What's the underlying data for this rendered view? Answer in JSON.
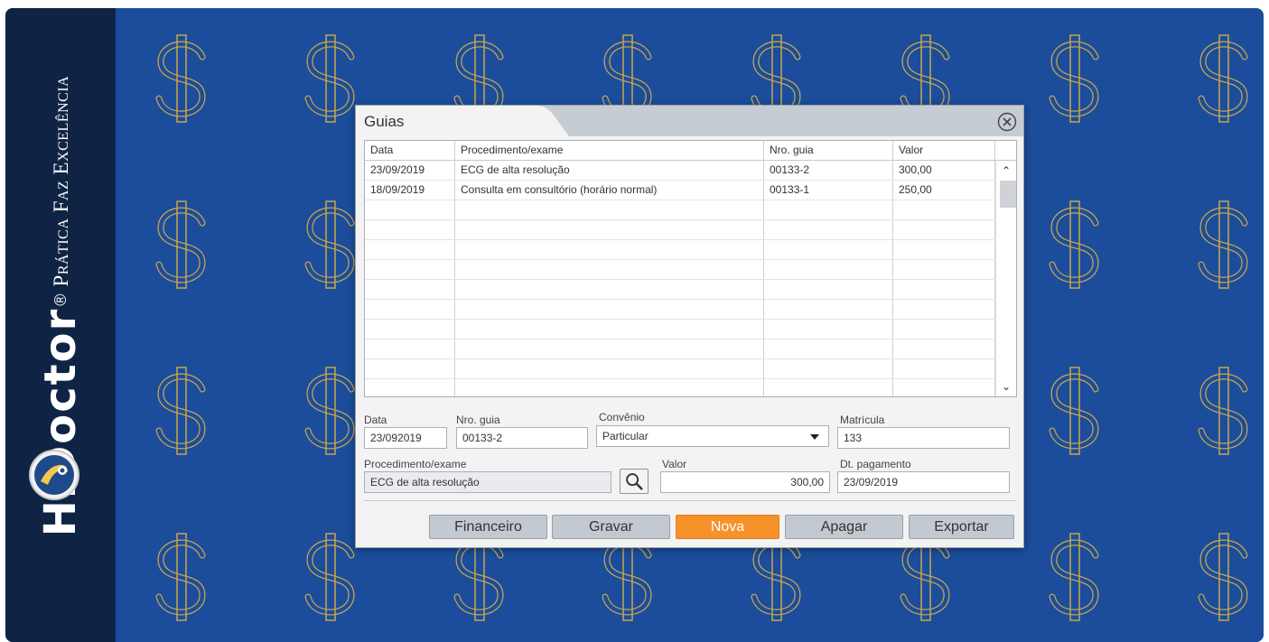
{
  "brand": {
    "name": "HiDoctor",
    "registered": "®",
    "tagline": "Prática Faz Excelência"
  },
  "colors": {
    "accent": "#f6922a",
    "background": "#1b4d9c",
    "sidebar": "#0f2445",
    "dollar_outline": "#c9a64a"
  },
  "dialog": {
    "title": "Guias",
    "columns": [
      "Data",
      "Procedimento/exame",
      "Nro. guia",
      "Valor"
    ],
    "rows": [
      {
        "data": "23/09/2019",
        "procedimento": "ECG de alta resolução",
        "guia": "00133-2",
        "valor": "300,00"
      },
      {
        "data": "18/09/2019",
        "procedimento": "Consulta em consultório (horário normal)",
        "guia": "00133-1",
        "valor": "250,00"
      }
    ],
    "form": {
      "data_label": "Data",
      "data_value": "23/092019",
      "guia_label": "Nro. guia",
      "guia_value": "00133-2",
      "convenio_label": "Convênio",
      "convenio_value": "Particular",
      "matricula_label": "Matrícula",
      "matricula_value": "133",
      "procedimento_label": "Procedimento/exame",
      "procedimento_value": "ECG de alta resolução",
      "valor_label": "Valor",
      "valor_value": "300,00",
      "pagamento_label": "Dt. pagamento",
      "pagamento_value": "23/09/2019"
    },
    "buttons": {
      "financeiro": "Financeiro",
      "gravar": "Gravar",
      "nova": "Nova",
      "apagar": "Apagar",
      "exportar": "Exportar"
    }
  }
}
